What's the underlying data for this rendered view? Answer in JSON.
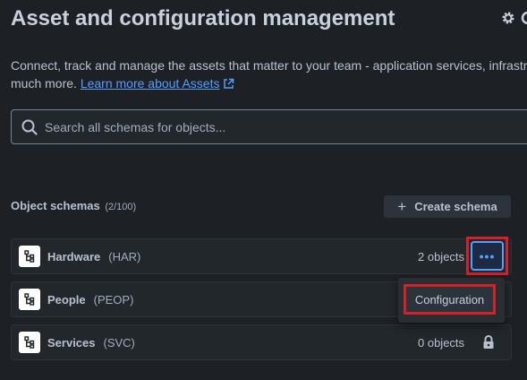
{
  "header": {
    "title": "Asset and configuration management",
    "settings_icon": "gear-icon"
  },
  "description": {
    "line1": "Connect, track and manage the assets that matter to your team - application services, infrastru",
    "line2_prefix": "much more. ",
    "learn_more_link": "Learn more about Assets",
    "link_icon": "external-link-icon"
  },
  "search": {
    "placeholder": "Search all schemas for objects..."
  },
  "schemas": {
    "title": "Object schemas",
    "count": "(2/100)",
    "create_label": "Create schema",
    "items": [
      {
        "name": "Hardware",
        "key": "(HAR)",
        "count": "2 objects",
        "icon": "hierarchy-icon"
      },
      {
        "name": "People",
        "key": "(PEOP)",
        "count": "",
        "icon": "hierarchy-icon"
      },
      {
        "name": "Services",
        "key": "(SVC)",
        "count": "0 objects",
        "icon": "hierarchy-icon",
        "locked": true
      }
    ]
  },
  "actions_menu": {
    "trigger_label": "•••",
    "items": [
      {
        "label": "Configuration"
      }
    ]
  },
  "colors": {
    "background": "#1d2125",
    "accent": "#579dff",
    "highlight_border": "#d42026"
  }
}
